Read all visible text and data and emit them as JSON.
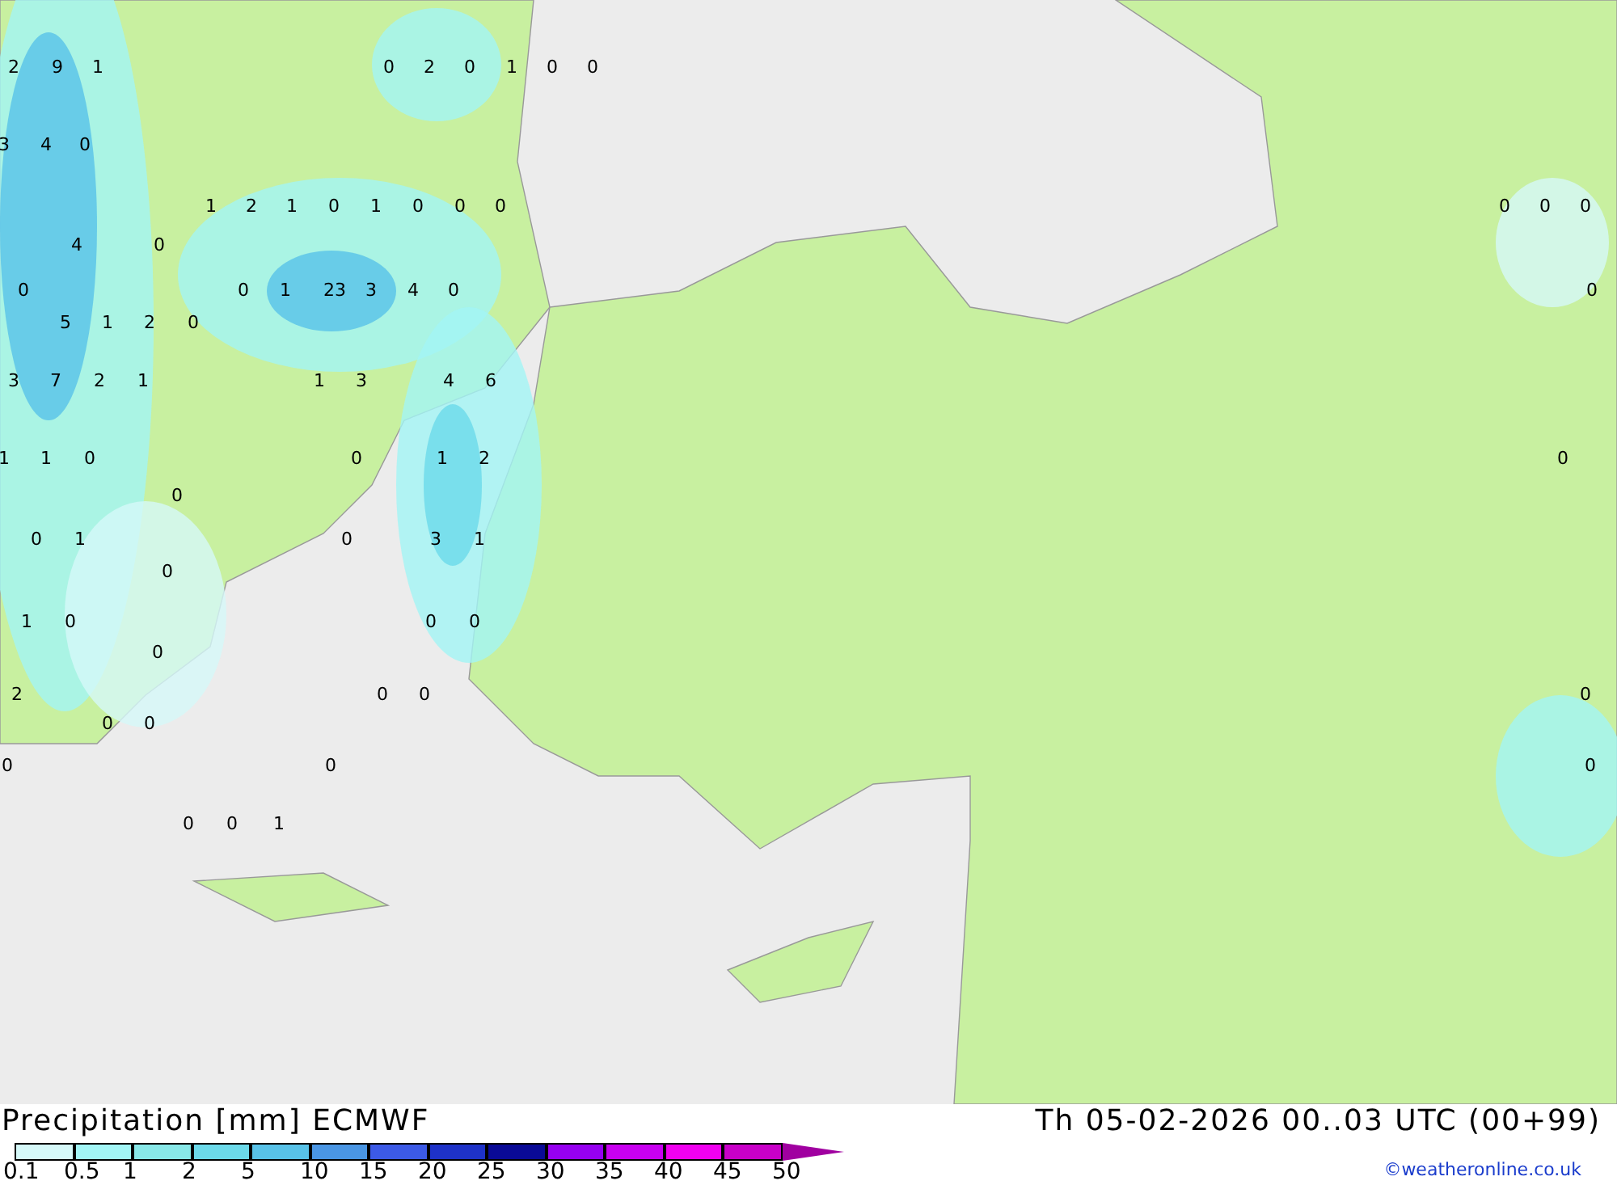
{
  "map": {
    "labels": [
      "2",
      "9",
      "1",
      "0",
      "2",
      "0",
      "1",
      "0",
      "0",
      "3",
      "4",
      "0",
      "1",
      "2",
      "1",
      "0",
      "1",
      "0",
      "0",
      "0",
      "0",
      "0",
      "0",
      "4",
      "0",
      "0",
      "0",
      "1",
      "23",
      "3",
      "4",
      "0",
      "0",
      "5",
      "1",
      "2",
      "0",
      "3",
      "7",
      "2",
      "1",
      "1",
      "3",
      "4",
      "6",
      "1",
      "1",
      "0",
      "0",
      "1",
      "2",
      "0",
      "0",
      "0",
      "1",
      "0",
      "3",
      "1",
      "0",
      "1",
      "0",
      "0",
      "0",
      "0",
      "2",
      "0",
      "0",
      "0",
      "0",
      "0",
      "0",
      "0",
      "0",
      "0",
      "0",
      "1"
    ]
  },
  "footer": {
    "title": "Precipitation [mm] ECMWF",
    "time": "Th 05-02-2026 00..03 UTC (00+99)",
    "copyright": "©weatheronline.co.uk"
  },
  "legend": {
    "bins": [
      {
        "color": "#d6f9f9"
      },
      {
        "color": "#a2f5f5"
      },
      {
        "color": "#88e8e8"
      },
      {
        "color": "#6cdaea"
      },
      {
        "color": "#58c2e8"
      },
      {
        "color": "#4a96e4"
      },
      {
        "color": "#3c5ae6"
      },
      {
        "color": "#1e32c8"
      },
      {
        "color": "#0a0a96"
      },
      {
        "color": "#9600f0"
      },
      {
        "color": "#c800f0"
      },
      {
        "color": "#f000f0"
      },
      {
        "color": "#c800c8"
      }
    ],
    "arrow": {
      "color": "#a000a0"
    },
    "ticks": [
      "0.1",
      "0.5",
      "1",
      "2",
      "5",
      "10",
      "15",
      "20",
      "25",
      "30",
      "35",
      "40",
      "45",
      "50"
    ]
  }
}
